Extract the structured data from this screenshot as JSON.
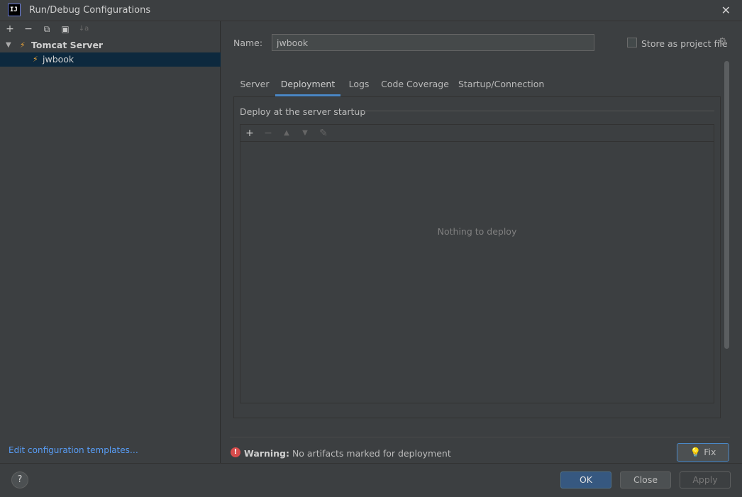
{
  "window": {
    "title": "Run/Debug Configurations",
    "logo_text": "IJ"
  },
  "left_toolbar": {
    "add": "+",
    "remove": "−",
    "copy": "⧉",
    "folder": "▣",
    "sort": "↓a"
  },
  "tree": {
    "group": {
      "label": "Tomcat Server",
      "expanded": true
    },
    "item": {
      "label": "jwbook",
      "selected": true
    }
  },
  "edit_templates_link": "Edit configuration templates…",
  "name": {
    "label": "Name:",
    "value": "jwbook"
  },
  "store_as_project_file": {
    "label": "Store as project file",
    "checked": false
  },
  "tabs": [
    {
      "label": "Server",
      "active": false
    },
    {
      "label": "Deployment",
      "active": true
    },
    {
      "label": "Logs",
      "active": false
    },
    {
      "label": "Code Coverage",
      "active": false
    },
    {
      "label": "Startup/Connection",
      "active": false
    }
  ],
  "deployment": {
    "section_title": "Deploy at the server startup",
    "toolbar": {
      "add": "+",
      "remove": "−",
      "up": "▲",
      "down": "▼",
      "edit": "✎"
    },
    "empty_text": "Nothing to deploy"
  },
  "warning": {
    "prefix": "Warning:",
    "message": " No artifacts marked for deployment",
    "color": "#d74c4c"
  },
  "fix_button": "Fix",
  "buttons": {
    "help": "?",
    "ok": "OK",
    "close": "Close",
    "apply": "Apply"
  },
  "colors": {
    "accent": "#4a88c7",
    "link": "#589df6",
    "selection": "#0d293e"
  }
}
